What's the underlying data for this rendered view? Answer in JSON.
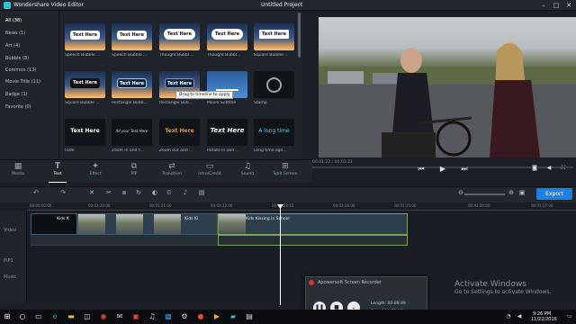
{
  "window": {
    "app_title": "Wondershare Video Editor",
    "project_title": "Untitled Project",
    "controls": [
      "–",
      "□",
      "✕"
    ]
  },
  "categories": [
    {
      "label": "All (38)",
      "selected": true
    },
    {
      "label": "News (1)"
    },
    {
      "label": "Art (4)"
    },
    {
      "label": "Bubble (8)"
    },
    {
      "label": "Common (13)"
    },
    {
      "label": "Movie Title (11)"
    },
    {
      "label": "Badge (1)"
    },
    {
      "label": "Favorite (0)"
    }
  ],
  "library": {
    "tiles": [
      {
        "text": "Text Here",
        "label": "Speech Bubble ..."
      },
      {
        "text": "Text Here",
        "label": "Speech Bubble ..."
      },
      {
        "text": "Text Here",
        "label": "Thought Bubbl..."
      },
      {
        "text": "Text Here",
        "label": "Thought Bubbl..."
      },
      {
        "text": "Text Here",
        "label": "Square Bubble ..."
      },
      {
        "text": "Text Here",
        "label": "Square Bubble ..."
      },
      {
        "text": "Text Here",
        "label": "Rectangle Bubb..."
      },
      {
        "text": "Text Here",
        "label": "Rectangle Bub..."
      },
      {
        "text": "",
        "label": "Movie Subtitle"
      },
      {
        "text": "",
        "label": "Stamp"
      },
      {
        "text": "Text Here",
        "label": "Fade"
      },
      {
        "text": "All your Text Here",
        "label": "Zoom in and F..."
      },
      {
        "text": "Text Here",
        "label": "Zoom out and ..."
      },
      {
        "text": "Text Here",
        "label": "Rotate in and ..."
      },
      {
        "text": "A long time",
        "label": "Long time ago..."
      }
    ],
    "tooltip": "Drag to timeline to apply"
  },
  "preview": {
    "time": "00:01:22 / 00:01:22"
  },
  "tools": [
    {
      "icon": "▦",
      "label": "Media"
    },
    {
      "icon": "T",
      "label": "Text",
      "selected": true
    },
    {
      "icon": "✦",
      "label": "Effect"
    },
    {
      "icon": "⧉",
      "label": "PIP"
    },
    {
      "icon": "⇄",
      "label": "Transition"
    },
    {
      "icon": "▭",
      "label": "Intro/Credit"
    },
    {
      "icon": "♫",
      "label": "Sound"
    },
    {
      "icon": "⊞",
      "label": "Split Screen"
    }
  ],
  "timeline": {
    "ruler": [
      "00:00:00:00",
      "00:01:20:00",
      "00:01:21:00",
      "00:01:22:00",
      "00:01:23:15",
      "00:01:24:00",
      "00:01:25:00",
      "00:01:26:00",
      "00:01:27:00"
    ],
    "tracks": [
      "Video",
      "PIP1",
      "Music"
    ],
    "clips": [
      {
        "name": "Kids K"
      },
      {
        "name": "Kids Ki"
      },
      {
        "name": "Kids Kissing in School"
      }
    ],
    "export_label": "Export"
  },
  "recorder": {
    "title": "Apowersoft Screen Recorder",
    "length": "Length: 00:09:49",
    "size": "Size: 100.78 MB"
  },
  "watermark": {
    "title": "Activate Windows",
    "subtitle": "Go to Settings to activate Windows."
  },
  "taskbar": {
    "time": "9:26 PM",
    "date": "11/22/2016"
  }
}
